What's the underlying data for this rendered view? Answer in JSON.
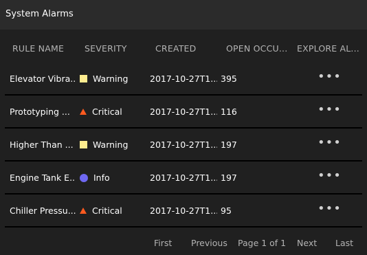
{
  "window": {
    "title": "System Alarms"
  },
  "table": {
    "columns": [
      "RULE NAME",
      "SEVERITY",
      "CREATED",
      "OPEN OCCU...",
      "EXPLORE AL..."
    ],
    "rows": [
      {
        "name": "Elevator Vibra...",
        "severity": "Warning",
        "severity_icon": "square-icon",
        "created": "2017-10-27T1...",
        "open": "395",
        "more": "•••"
      },
      {
        "name": "Prototyping ...",
        "severity": "Critical",
        "severity_icon": "triangle-icon",
        "created": "2017-10-27T1...",
        "open": "116",
        "more": "•••"
      },
      {
        "name": "Higher Than ...",
        "severity": "Warning",
        "severity_icon": "square-icon",
        "created": "2017-10-27T1...",
        "open": "197",
        "more": "•••"
      },
      {
        "name": "Engine Tank E...",
        "severity": "Info",
        "severity_icon": "circle-icon",
        "created": "2017-10-27T1...",
        "open": "197",
        "more": "•••"
      },
      {
        "name": "Chiller Pressu...",
        "severity": "Critical",
        "severity_icon": "triangle-icon",
        "created": "2017-10-27T1...",
        "open": "95",
        "more": "•••"
      }
    ]
  },
  "pagination": {
    "first": "First",
    "previous": "Previous",
    "page_info": "Page 1 of 1",
    "next": "Next",
    "last": "Last"
  },
  "colors": {
    "warning": "#fdec8f",
    "critical": "#ff5a1f",
    "info": "#6f68f2",
    "background": "#202020",
    "titlebar": "#2b2b2b"
  }
}
